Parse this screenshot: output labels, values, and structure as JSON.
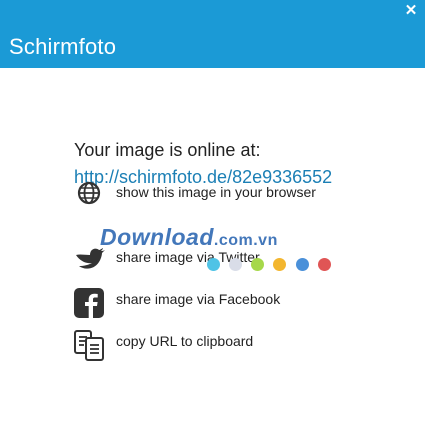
{
  "window": {
    "title": "Schirmfoto",
    "close_glyph": "✕"
  },
  "main": {
    "heading": "Your image is online at:",
    "url": "http://schirmfoto.de/82e9336552"
  },
  "actions": [
    {
      "label": "show this image in your browser",
      "icon": "globe-icon"
    },
    {
      "label": "share image via Twitter",
      "icon": "twitter-icon"
    },
    {
      "label": "share image via Facebook",
      "icon": "facebook-icon"
    },
    {
      "label": "copy URL to clipboard",
      "icon": "clipboard-icon"
    }
  ],
  "watermark": {
    "brand": "Download",
    "suffix": ".com.vn",
    "dot_colors": [
      "#4fc3e6",
      "#d9dde8",
      "#a6d84a",
      "#f3b62f",
      "#4a90d9",
      "#e05555"
    ]
  },
  "colors": {
    "titlebar": "#1b9ad6",
    "link": "#1b7fb5",
    "icon": "#333333"
  }
}
